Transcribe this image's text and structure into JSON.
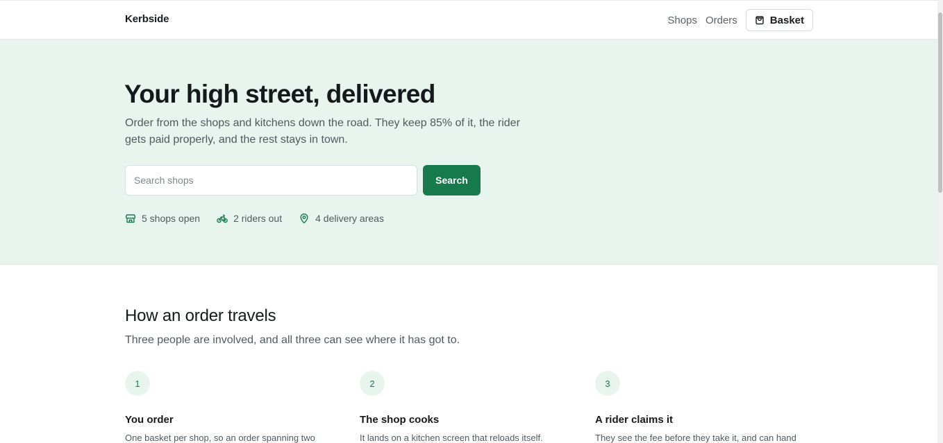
{
  "brand": "Kerbside",
  "nav": {
    "links": [
      "Shops",
      "Orders"
    ],
    "basket_label": "Basket"
  },
  "hero": {
    "title": "Your high street, delivered",
    "lead": "Order from the shops and kitchens down the road. They keep 85% of it, the rider gets paid properly, and the rest stays in town.",
    "search_placeholder": "Search shops",
    "search_label": "Search",
    "stats": [
      {
        "icon": "shop-icon",
        "label": "5 shops open"
      },
      {
        "icon": "bicycle-icon",
        "label": "2 riders out"
      },
      {
        "icon": "map-pin-icon",
        "label": "4 delivery areas"
      }
    ]
  },
  "how": {
    "title": "How an order travels",
    "subtitle": "Three people are involved, and all three can see where it has got to.",
    "steps": [
      {
        "num": "1",
        "title": "You order",
        "text": "One basket per shop, so an order spanning two"
      },
      {
        "num": "2",
        "title": "The shop cooks",
        "text": "It lands on a kitchen screen that reloads itself."
      },
      {
        "num": "3",
        "title": "A rider claims it",
        "text": "They see the fee before they take it, and can hand"
      }
    ]
  },
  "colors": {
    "accent": "#177a4c",
    "hero_bg": "#e8f4ee"
  }
}
